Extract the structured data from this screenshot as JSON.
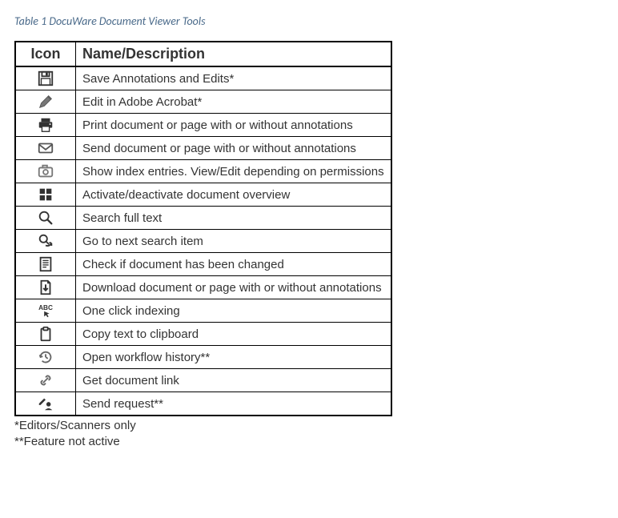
{
  "caption": "Table 1 DocuWare Document Viewer Tools",
  "table": {
    "headers": {
      "icon": "Icon",
      "desc": "Name/Description"
    },
    "rows": [
      {
        "icon": "save-icon",
        "desc": "Save Annotations and Edits*"
      },
      {
        "icon": "pencil-icon",
        "desc": "Edit in Adobe Acrobat*"
      },
      {
        "icon": "print-icon",
        "desc": "Print document or page with or without annotations"
      },
      {
        "icon": "envelope-icon",
        "desc": "Send document or page with or without annotations"
      },
      {
        "icon": "camera-icon",
        "desc": "Show index entries. View/Edit depending on permissions"
      },
      {
        "icon": "tiles-icon",
        "desc": "Activate/deactivate document overview"
      },
      {
        "icon": "search-icon",
        "desc": "Search full text"
      },
      {
        "icon": "search-next-icon",
        "desc": "Go to next search item"
      },
      {
        "icon": "doc-list-icon",
        "desc": "Check if document has been changed"
      },
      {
        "icon": "download-icon",
        "desc": "Download document or page with or without annotations"
      },
      {
        "icon": "abc-point-icon",
        "desc": "One click indexing"
      },
      {
        "icon": "clipboard-icon",
        "desc": "Copy text to clipboard"
      },
      {
        "icon": "history-icon",
        "desc": "Open workflow history**"
      },
      {
        "icon": "link-icon",
        "desc": "Get document link"
      },
      {
        "icon": "send-request-icon",
        "desc": "Send request**"
      }
    ]
  },
  "footnotes": [
    "*Editors/Scanners only",
    "**Feature not active"
  ]
}
